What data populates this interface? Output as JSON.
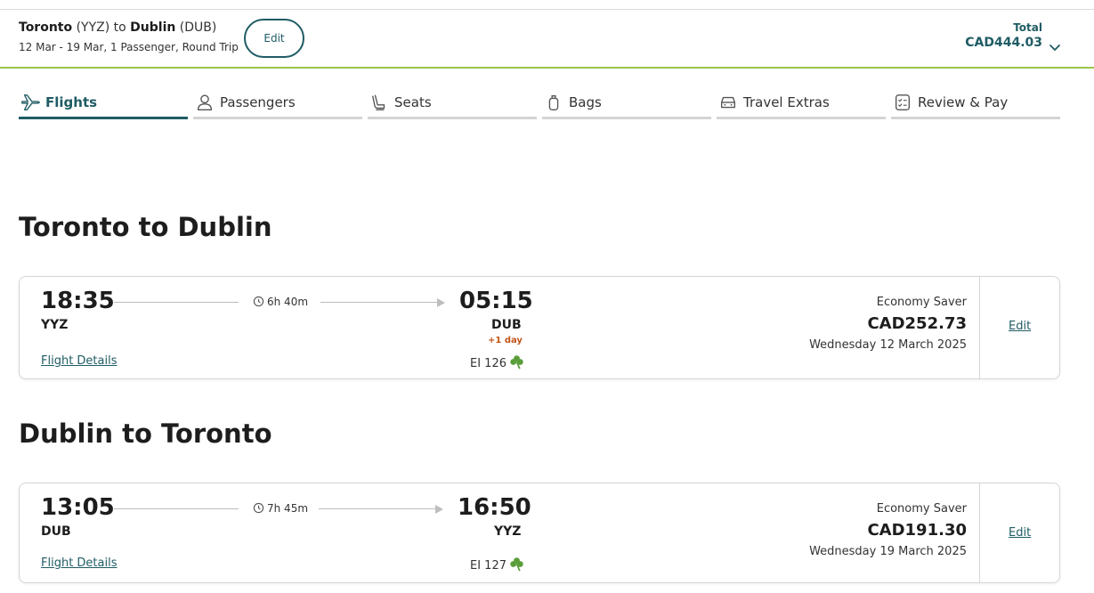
{
  "header": {
    "origin_city": "Toronto",
    "origin_code": "(YYZ)",
    "connector": "to",
    "dest_city": "Dublin",
    "dest_code": "(DUB)",
    "trip_summary": "12 Mar - 19 Mar, 1 Passenger, Round Trip",
    "edit_label": "Edit",
    "total_label": "Total",
    "total_value": "CAD444.03"
  },
  "steps": [
    {
      "label": "Flights",
      "icon": "plane-icon",
      "active": true
    },
    {
      "label": "Passengers",
      "icon": "person-icon",
      "active": false
    },
    {
      "label": "Seats",
      "icon": "seat-icon",
      "active": false
    },
    {
      "label": "Bags",
      "icon": "bag-icon",
      "active": false
    },
    {
      "label": "Travel Extras",
      "icon": "car-icon",
      "active": false
    },
    {
      "label": "Review & Pay",
      "icon": "checklist-icon",
      "active": false
    }
  ],
  "outbound": {
    "title": "Toronto to Dublin",
    "depart_time": "18:35",
    "depart_code": "YYZ",
    "duration": "6h 40m",
    "arrive_time": "05:15",
    "arrive_code": "DUB",
    "day_offset": "+1 day",
    "details_label": "Flight Details",
    "flight_number": "EI 126",
    "fare_name": "Economy Saver",
    "fare_price": "CAD252.73",
    "date": "Wednesday 12 March 2025",
    "edit_label": "Edit"
  },
  "inbound": {
    "title": "Dublin to Toronto",
    "depart_time": "13:05",
    "depart_code": "DUB",
    "duration": "7h 45m",
    "arrive_time": "16:50",
    "arrive_code": "YYZ",
    "details_label": "Flight Details",
    "flight_number": "EI 127",
    "fare_name": "Economy Saver",
    "fare_price": "CAD191.30",
    "date": "Wednesday 19 March 2025",
    "edit_label": "Edit"
  },
  "colors": {
    "accent": "#1f5c64",
    "header_rule": "#9cc54a",
    "day_offset": "#c0551a",
    "shamrock": "#5a9e3a"
  }
}
